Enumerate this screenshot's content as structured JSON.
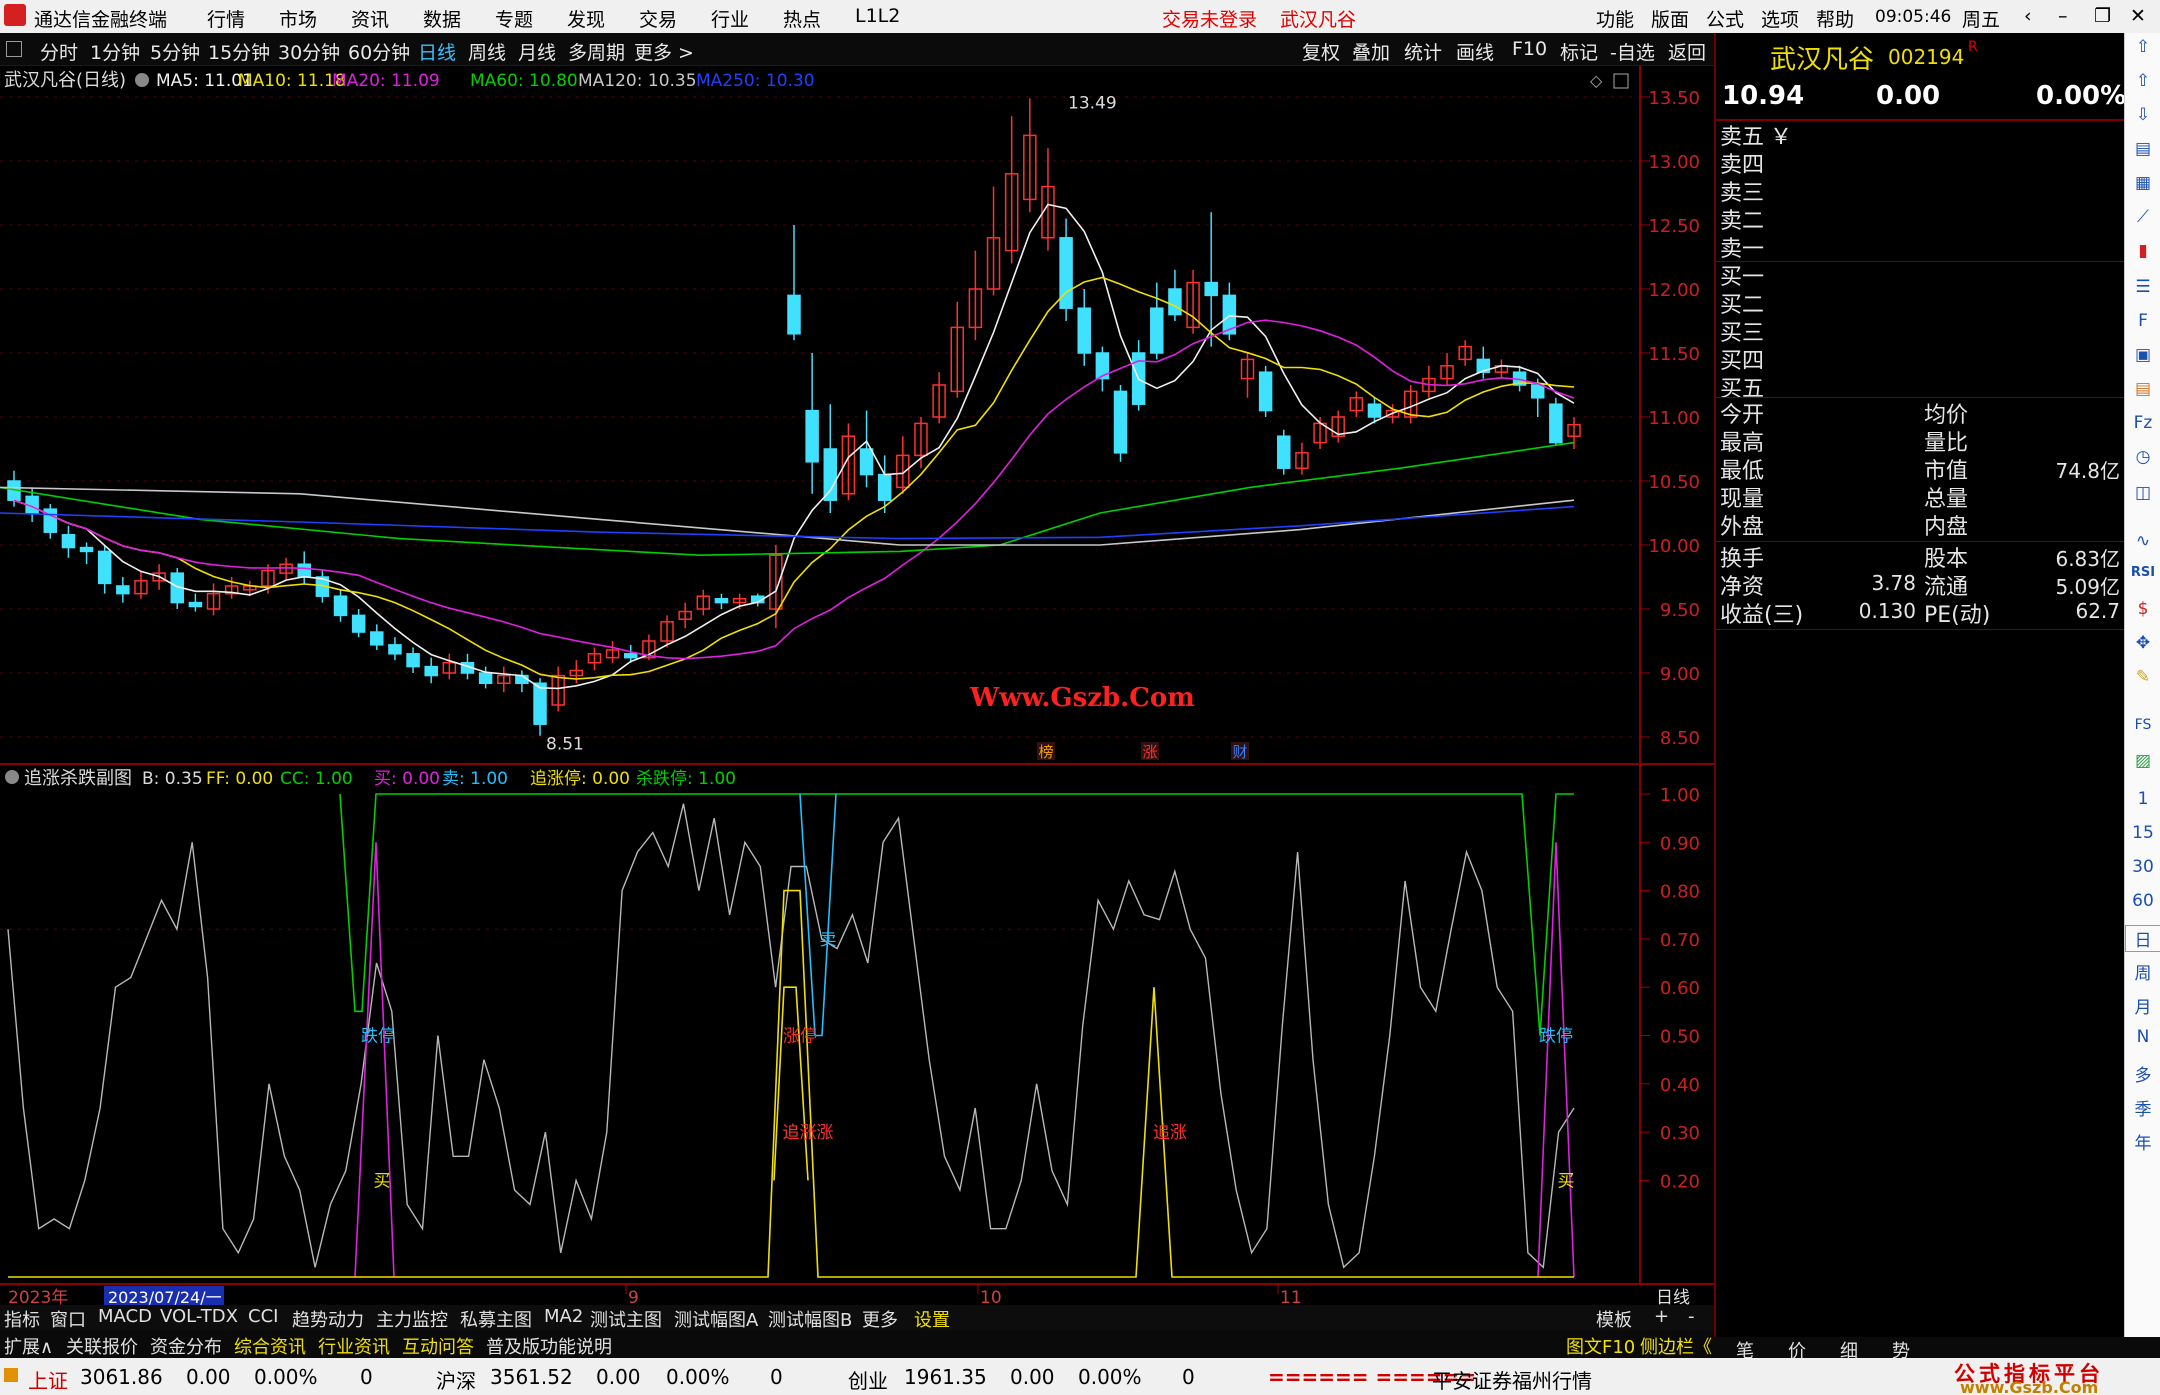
{
  "titlebar": {
    "app_name": "通达信金融终端",
    "menus": [
      "行情",
      "市场",
      "资讯",
      "数据",
      "专题",
      "发现",
      "交易",
      "行业",
      "热点",
      "L1L2"
    ],
    "login_status": "交易未登录",
    "stock_name": "武汉凡谷",
    "right_menus": [
      "功能",
      "版面",
      "公式",
      "选项",
      "帮助"
    ],
    "time": "09:05:46",
    "weekday": "周五"
  },
  "toolbar": {
    "periods": [
      "分时",
      "1分钟",
      "5分钟",
      "15分钟",
      "30分钟",
      "60分钟",
      "日线",
      "周线",
      "月线",
      "多周期",
      "更多 >"
    ],
    "active_period": "日线",
    "right_buttons": [
      "复权",
      "叠加",
      "统计",
      "画线",
      "F10",
      "标记",
      "-自选",
      "返回"
    ]
  },
  "main_chart": {
    "title": "武汉凡谷(日线)",
    "ma": [
      {
        "label": "MA5: 11.01",
        "color": "#f0f0f0"
      },
      {
        "label": "MA10: 11.18",
        "color": "#f0e000"
      },
      {
        "label": "MA20: 11.09",
        "color": "#e020e0"
      },
      {
        "label": "MA60: 10.80",
        "color": "#00d000"
      },
      {
        "label": "MA120: 10.35",
        "color": "#c8c8c8"
      },
      {
        "label": "MA250: 10.30",
        "color": "#2040ff"
      }
    ],
    "y_labels": [
      "13.50",
      "13.00",
      "12.50",
      "12.00",
      "11.50",
      "11.00",
      "10.50",
      "10.00",
      "9.50",
      "9.00",
      "8.50"
    ],
    "high_mark": "13.49",
    "low_mark": "8.51",
    "watermark": "Www.Gszb.Com",
    "event_tags": [
      "榜",
      "涨",
      "财"
    ]
  },
  "sub_chart": {
    "title": "追涨杀跌副图",
    "items": [
      {
        "label": "B: 0.35",
        "color": "#dcdcdc"
      },
      {
        "label": "FF: 0.00",
        "color": "#f0e000"
      },
      {
        "label": "CC: 1.00",
        "color": "#00d000"
      },
      {
        "label": "买: 0.00",
        "color": "#e020e0"
      },
      {
        "label": "卖: 1.00",
        "color": "#20c0ff"
      },
      {
        "label": "追涨停: 0.00",
        "color": "#f0e000"
      },
      {
        "label": "杀跌停: 1.00",
        "color": "#00d000"
      }
    ],
    "y_labels": [
      "1.00",
      "0.90",
      "0.80",
      "0.70",
      "0.60",
      "0.50",
      "0.40",
      "0.30",
      "0.20"
    ],
    "markers": [
      {
        "text": "跌停",
        "color": "#20c0ff"
      },
      {
        "text": "买",
        "color": "#f0e000"
      },
      {
        "text": "涨停",
        "color": "#ff3030"
      },
      {
        "text": "追涨涨",
        "color": "#ff3030"
      },
      {
        "text": "卖",
        "color": "#20c0ff"
      },
      {
        "text": "追涨",
        "color": "#ff3030"
      },
      {
        "text": "跌停",
        "color": "#20c0ff"
      },
      {
        "text": "买",
        "color": "#f0e000"
      }
    ]
  },
  "x_axis": {
    "year": "2023年",
    "cursor_date": "2023/07/24/一",
    "months": [
      "9",
      "10",
      "11"
    ],
    "period_label": "日线"
  },
  "tabs_row1": [
    "指标",
    "窗口",
    "MACD",
    "VOL-TDX",
    "CCI",
    "趋势动力",
    "主力监控",
    "私募主图",
    "MA2",
    "测试主图",
    "测试幅图A",
    "测试幅图B",
    "更多",
    "设置"
  ],
  "tabs_row1_right": [
    "模板",
    "+",
    "-"
  ],
  "tabs_row2": [
    "扩展∧",
    "关联报价",
    "资金分布",
    "综合资讯",
    "行业资讯",
    "互动问答",
    "普及版功能说明"
  ],
  "tabs_row2_right": [
    "图文F10",
    "侧边栏《"
  ],
  "right_tabs": [
    "笔",
    "价",
    "细",
    "势"
  ],
  "quote": {
    "name": "武汉凡谷",
    "code": "002194",
    "flag": "R",
    "price": "10.94",
    "change": "0.00",
    "pct": "0.00%",
    "sell": [
      "卖五",
      "卖四",
      "卖三",
      "卖二",
      "卖一"
    ],
    "sell_extra": "￥",
    "buy": [
      "买一",
      "买二",
      "买三",
      "买四",
      "买五"
    ],
    "left_labels": [
      "今开",
      "最高",
      "最低",
      "现量",
      "外盘"
    ],
    "right_labels": [
      "均价",
      "量比",
      "市值",
      "总量",
      "内盘"
    ],
    "right_values": [
      "",
      "",
      "74.8亿",
      "",
      ""
    ],
    "fin_left": [
      "换手",
      "净资",
      "收益(三)"
    ],
    "fin_left_values": [
      "",
      "3.78",
      "0.130"
    ],
    "fin_right": [
      "股本",
      "流通",
      "PE(动)"
    ],
    "fin_right_values": [
      "6.83亿",
      "5.09亿",
      "62.7"
    ]
  },
  "sidebar": [
    "1",
    "15",
    "30",
    "60",
    "日",
    "周",
    "月",
    "N",
    "多",
    "季",
    "年"
  ],
  "status": {
    "indices": [
      {
        "name": "上证",
        "value": "3061.86",
        "chg": "0.00",
        "pct": "0.00%",
        "vol": "0"
      },
      {
        "name": "沪深",
        "value": "3561.52",
        "chg": "0.00",
        "pct": "0.00%",
        "vol": "0"
      },
      {
        "name": "创业",
        "value": "1961.35",
        "chg": "0.00",
        "pct": "0.00%",
        "vol": "0"
      }
    ],
    "bar": "====== ======",
    "broker": "平安证券福州行情",
    "brand": "公式指标平台",
    "brand_url": "www.Gszb.Com"
  }
}
